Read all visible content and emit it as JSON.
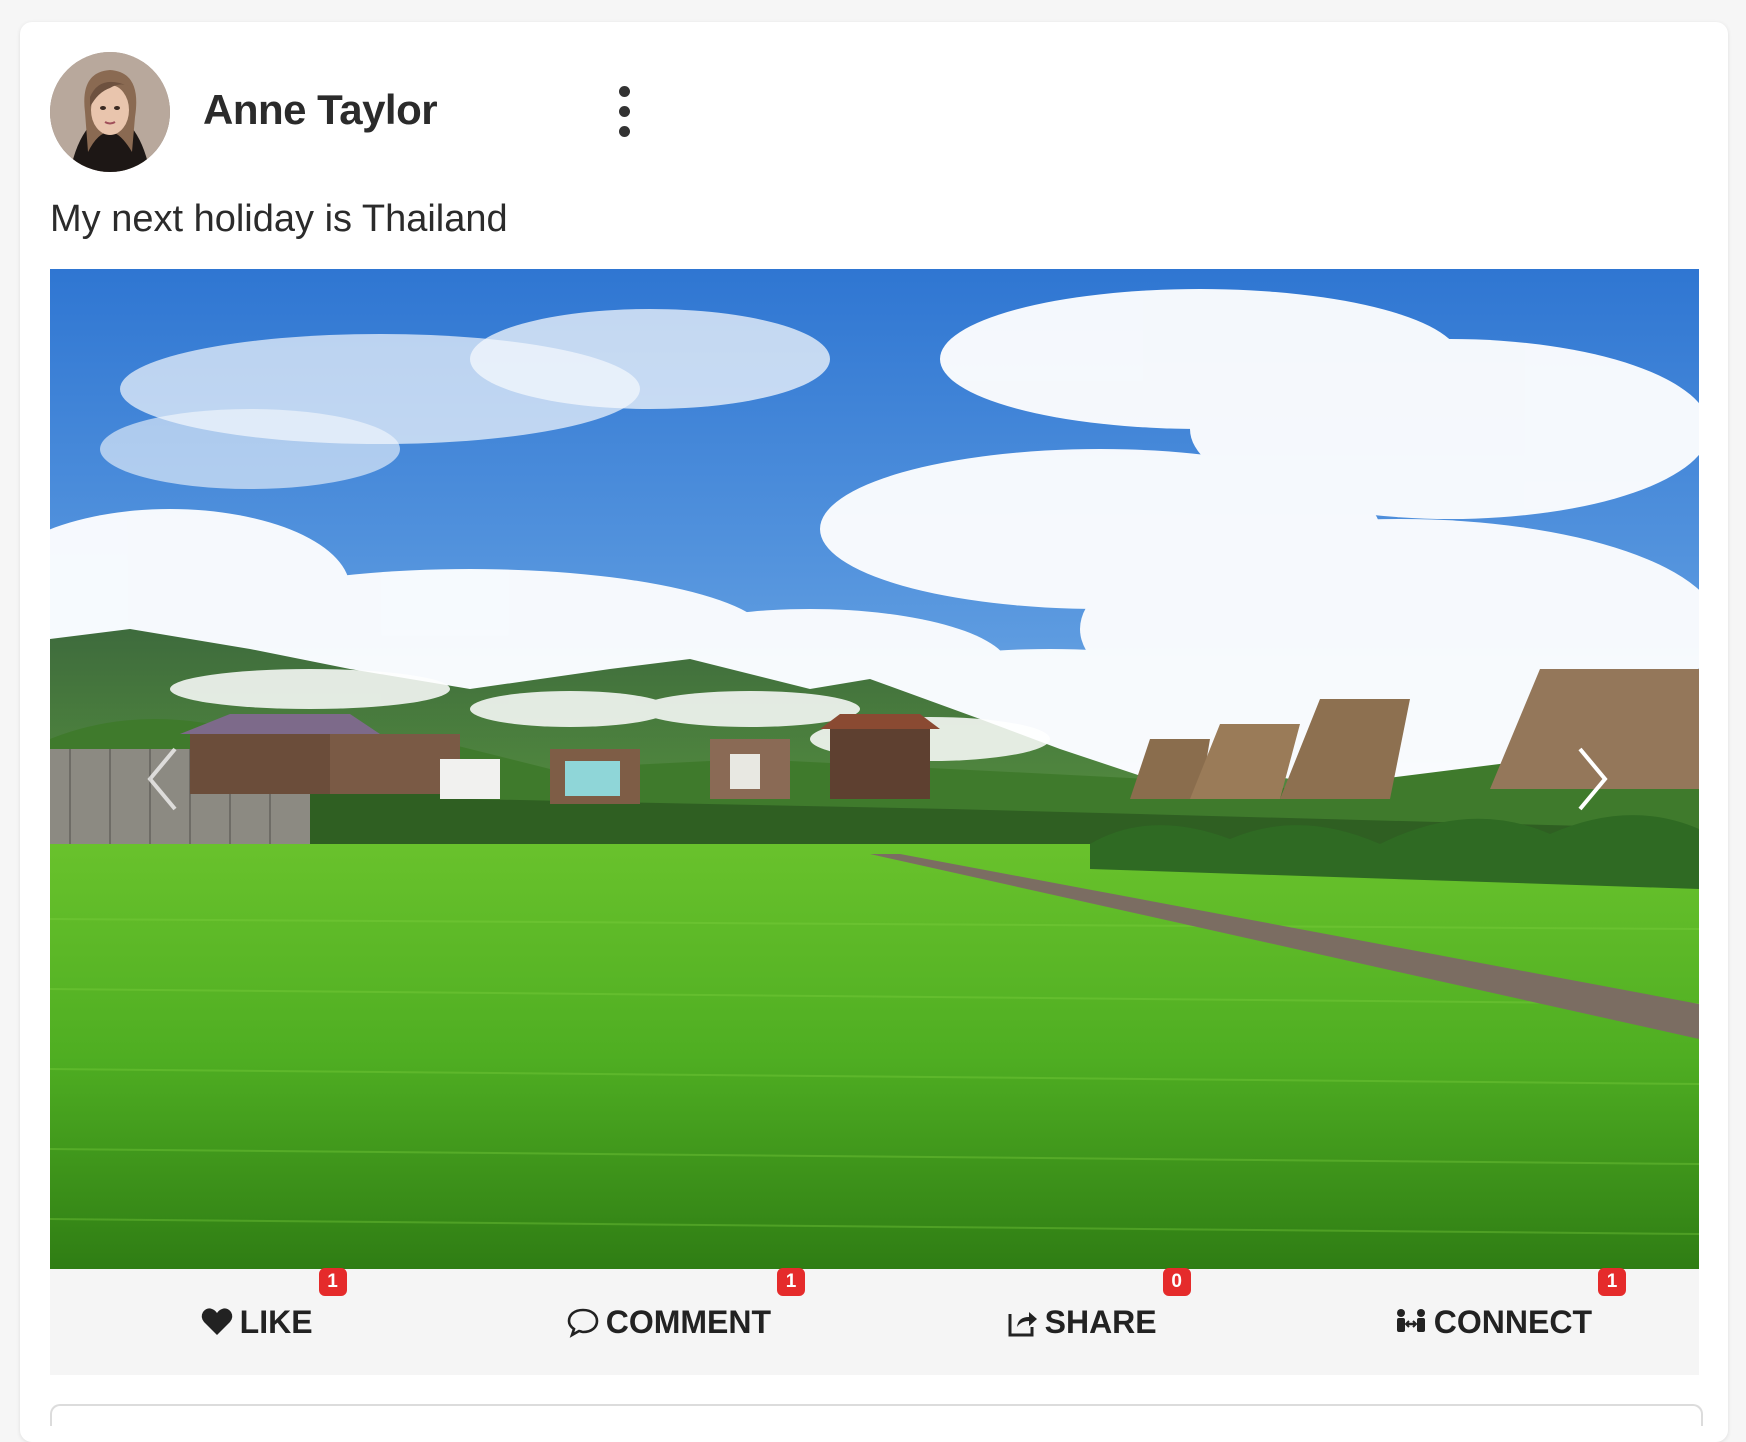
{
  "post": {
    "author": "Anne Taylor",
    "caption": "My next holiday is Thailand"
  },
  "actions": [
    {
      "label": "LIKE",
      "count": "1",
      "icon": "heart-icon"
    },
    {
      "label": "COMMENT",
      "count": "1",
      "icon": "comment-icon"
    },
    {
      "label": "SHARE",
      "count": "0",
      "icon": "share-icon"
    },
    {
      "label": "CONNECT",
      "count": "1",
      "icon": "connect-icon"
    }
  ],
  "colors": {
    "badge": "#e52b2b",
    "action_bar": "#f5f5f5",
    "sky": "#3b82d6",
    "field": "#5bbf2a"
  }
}
